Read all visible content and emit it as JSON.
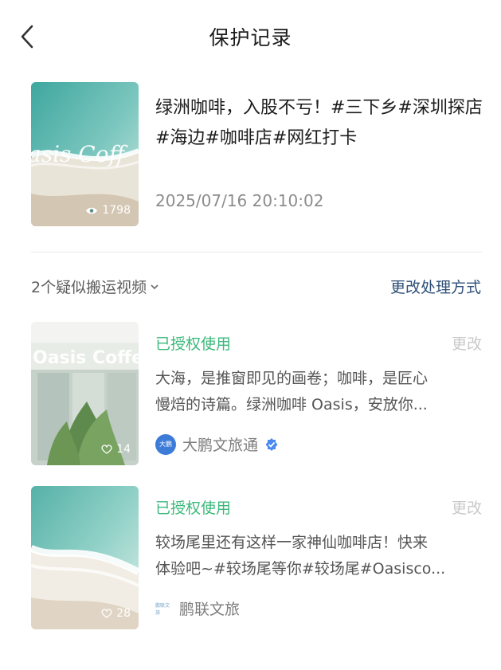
{
  "header": {
    "title": "保护记录",
    "back_icon": "chevron-left-icon"
  },
  "original": {
    "title": "绿洲咖啡，入股不亏！#三下乡#深圳探店#海边#咖啡店#网红打卡",
    "views": "1798",
    "thumb_text": "asis  Coff",
    "time": "2025/07/16 20:10:02"
  },
  "section": {
    "label": "2个疑似搬运视频",
    "action": "更改处理方式"
  },
  "items": [
    {
      "status": "已授权使用",
      "change": "更改",
      "desc_line1": "大海，是推窗即见的画卷；咖啡，是匠心",
      "desc_line2": "慢焙的诗篇。绿洲咖啡 Oasis，安放你...",
      "author": "大鹏文旅通",
      "avatar_text": "大鹏",
      "likes": "14",
      "thumb_text": "Oasis Coffe"
    },
    {
      "status": "已授权使用",
      "change": "更改",
      "desc_line1": "较场尾里还有这样一家神仙咖啡店！快来",
      "desc_line2": "体验吧~#较场尾等你#较场尾#Oasisco...",
      "author": "鹏联文旅",
      "avatar_text": "鹏联文旅",
      "likes": "28"
    }
  ],
  "colors": {
    "accent_green": "#3cb87c",
    "link_blue": "#2f4f78",
    "verified_blue": "#4a8af0"
  }
}
